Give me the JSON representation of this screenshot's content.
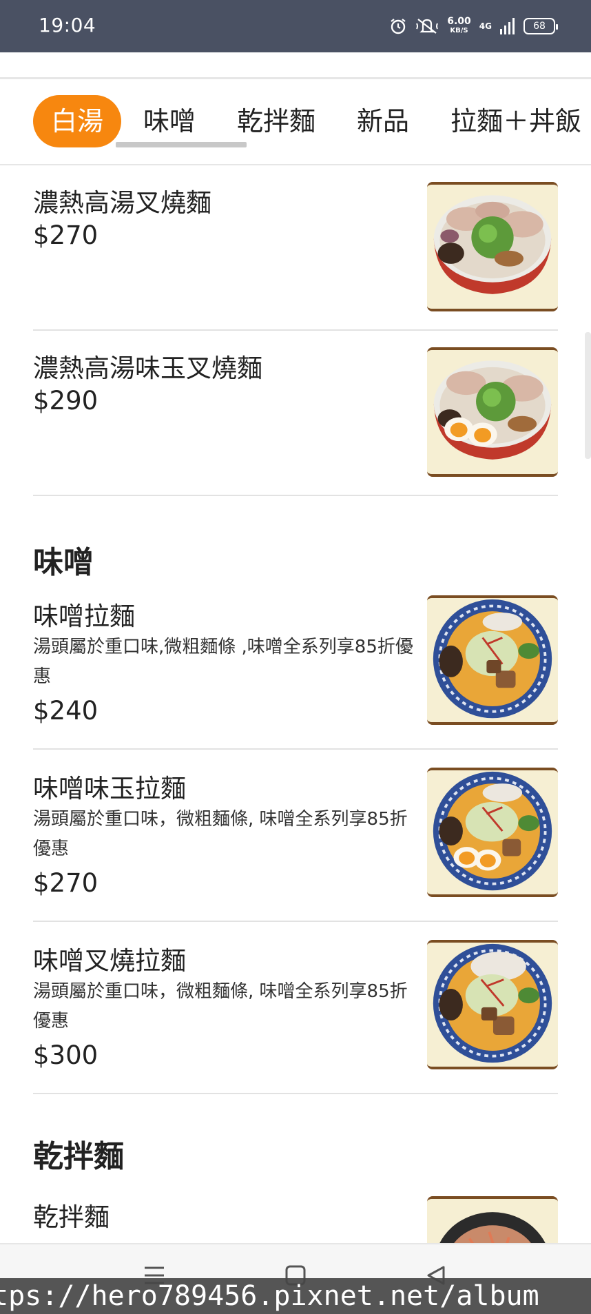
{
  "status_bar": {
    "time": "19:04",
    "speed_value": "6.00",
    "speed_unit": "KB/S",
    "network": "4G",
    "battery": "68",
    "icons": [
      "alarm-icon",
      "mute-icon",
      "signal-icon",
      "battery-icon"
    ]
  },
  "tabs": [
    {
      "label": "白湯",
      "active": true
    },
    {
      "label": "味噌",
      "active": false
    },
    {
      "label": "乾拌麵",
      "active": false
    },
    {
      "label": "新品",
      "active": false
    },
    {
      "label": "拉麵＋丼飯",
      "active": false
    }
  ],
  "items": [
    {
      "name": "濃熱高湯叉燒麵",
      "price": "$270",
      "image": "tonkotsu-chashu-ramen"
    },
    {
      "name": "濃熱高湯味玉叉燒麵",
      "price": "$290",
      "image": "tonkotsu-egg-chashu-ramen"
    },
    {
      "name": "味噌拉麵",
      "desc": "湯頭屬於重口味,微粗麵條 ,味噌全系列享85折優惠",
      "price": "$240",
      "image": "miso-ramen"
    },
    {
      "name": "味噌味玉拉麵",
      "desc": "湯頭屬於重口味，微粗麵條, 味噌全系列享85折優惠",
      "price": "$270",
      "image": "miso-egg-ramen"
    },
    {
      "name": "味噌叉燒拉麵",
      "desc": "湯頭屬於重口味，微粗麵條, 味噌全系列享85折優惠",
      "price": "$300",
      "image": "miso-chashu-ramen"
    },
    {
      "name": "乾拌麵",
      "image": "dry-noodles"
    }
  ],
  "sections": {
    "miso": "味噌",
    "dry": "乾拌麵"
  },
  "watermark": "tps://hero789456.pixnet.net/album",
  "colors": {
    "status_bar": "#4a5163",
    "accent": "#f7870f",
    "divider": "#e2e2e2"
  }
}
